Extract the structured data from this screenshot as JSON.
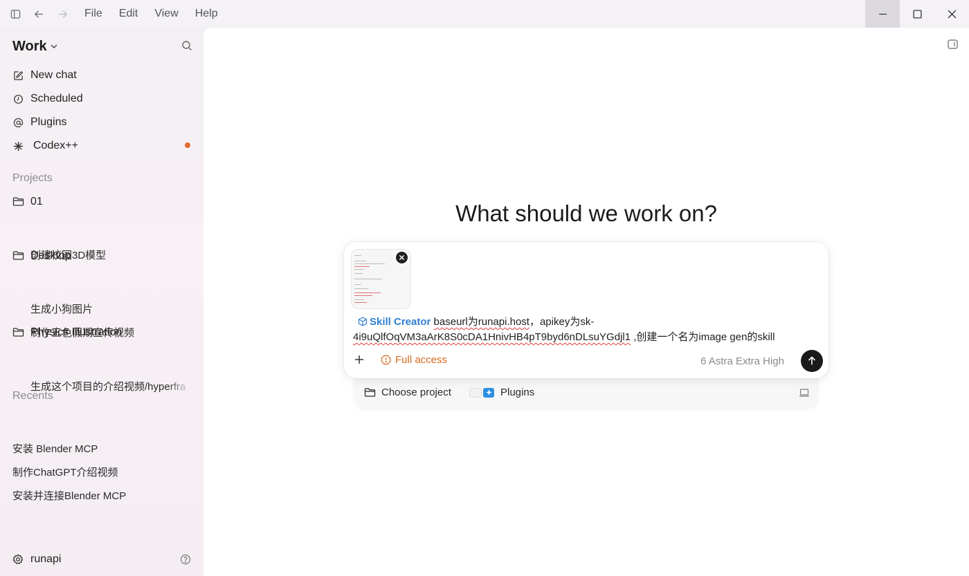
{
  "menu": [
    "File",
    "Edit",
    "View",
    "Help"
  ],
  "workspace": {
    "name": "Work"
  },
  "nav": {
    "new_chat": "New chat",
    "scheduled": "Scheduled",
    "plugins": "Plugins",
    "codex": "Codex++"
  },
  "projects": {
    "label": "Projects",
    "groups": [
      {
        "name": "01",
        "threads": [
          "创建校园3D模型"
        ]
      },
      {
        "name": "Desktop",
        "threads": [
          "生成小狗图片",
          "制作五色假期宣传视频"
        ]
      },
      {
        "name": "Physics Illustration",
        "threads": [
          "生成这个项目的介绍视频/hyperfra"
        ]
      }
    ]
  },
  "recents": {
    "label": "Recents",
    "items": [
      "安装 Blender MCP",
      "制作ChatGPT介绍视频",
      "安装并连接Blender MCP"
    ]
  },
  "user": {
    "name": "runapi"
  },
  "headline": "What should we work on?",
  "composer": {
    "skill": "Skill Creator",
    "text_1": "baseurl为runapi.host",
    "text_2": "，apikey为sk-",
    "text_3": "4i9uQlfOqVM3aArK8S0cDA1HnivHB4pT9byd6nDLsuYGdjl1",
    "text_4": " ,创建一个名为image gen的skill",
    "access": "Full access",
    "model": "6 Astra  Extra High"
  },
  "subbar": {
    "project": "Choose project",
    "plugins": "Plugins"
  },
  "colors": {
    "accent_orange": "#d76a1f",
    "skill_blue": "#2f7fd1",
    "dot": "#e4692e"
  }
}
